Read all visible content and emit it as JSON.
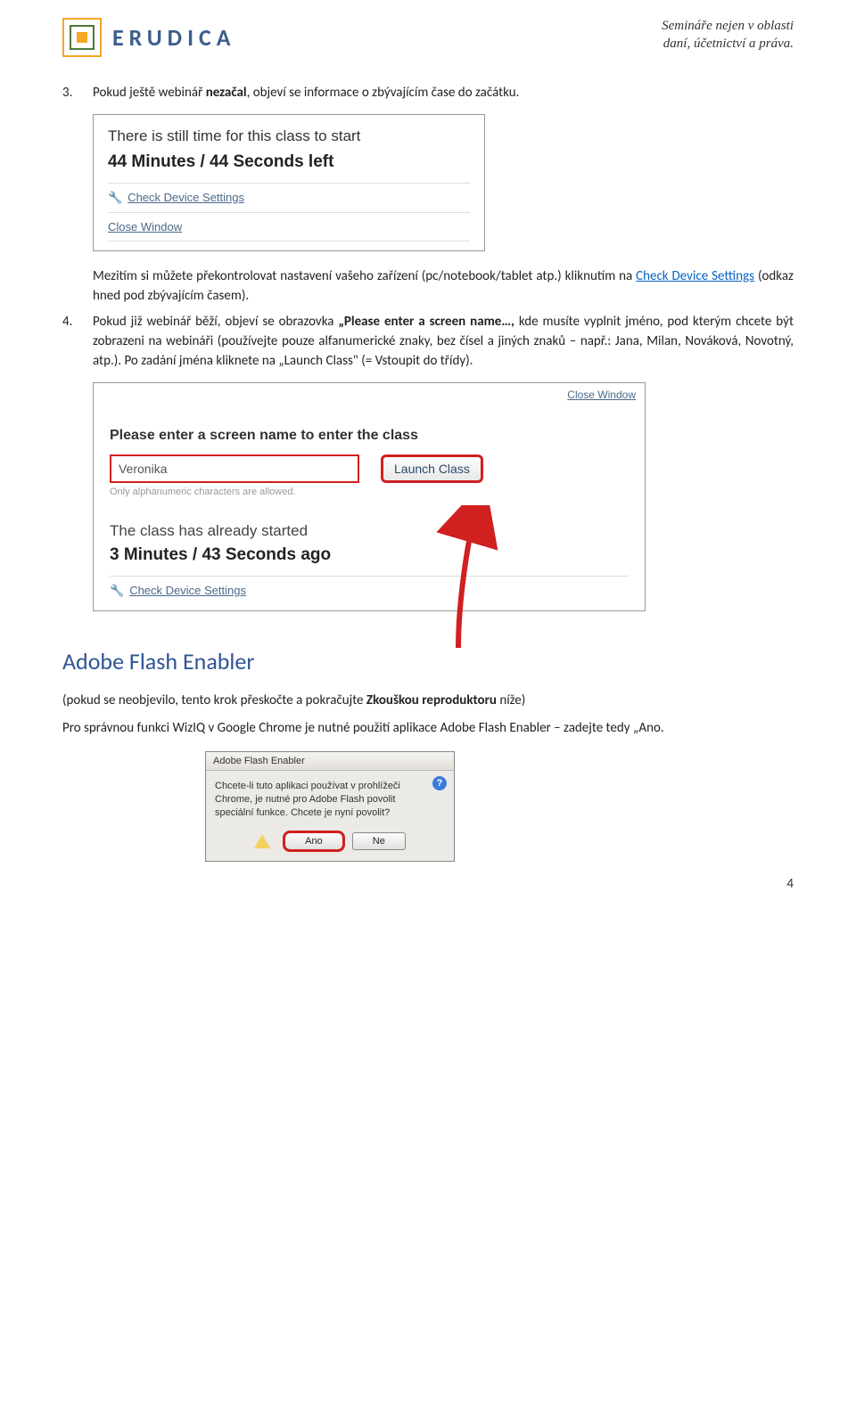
{
  "header": {
    "brand": "ERUDICA",
    "tagline1": "Semináře nejen v oblasti",
    "tagline2": "daní, účetnictví a práva."
  },
  "step3": {
    "num": "3.",
    "text_before_bold": "Pokud ještě webinář ",
    "bold": "nezačal",
    "text_after_bold": ", objeví se informace o zbývajícím čase do začátku."
  },
  "shot1": {
    "title": "There is still time for this class to start",
    "time": "44 Minutes / 44 Seconds left",
    "check": "Check Device Settings",
    "close": "Close Window"
  },
  "step3b": {
    "text_a": "Mezitím si můžete překontrolovat nastavení vašeho zařízení (pc/notebook/tablet atp.) kliknutím na ",
    "link": "Check Device Settings",
    "text_b": " (odkaz hned pod zbývajícím časem)."
  },
  "step4": {
    "num": "4.",
    "t1": "Pokud již webinář běží, objeví se obrazovka ",
    "b1": "„Please enter a screen name…,",
    "t2": " kde musíte vyplnit jméno, pod kterým chcete být zobrazeni na webináři (používejte pouze alfanumerické znaky, bez čísel a jiných znaků – např.: Jana, Milan, Nováková, Novotný, atp.). Po zadání jména kliknete na „Launch Class\" (= Vstoupit do třídy)."
  },
  "shot2": {
    "close": "Close Window",
    "prompt": "Please enter a screen name to enter the class",
    "name_value": "Veronika",
    "launch": "Launch Class",
    "hint": "Only alphanumeric characters are allowed.",
    "started_title": "The class has already started",
    "started_time": "3 Minutes / 43 Seconds ago",
    "check": "Check Device Settings"
  },
  "section": {
    "title": "Adobe Flash Enabler",
    "p1a": "(pokud se neobjevilo, tento krok přeskočte a pokračujte ",
    "p1b": "Zkouškou reproduktoru",
    "p1c": " níže)",
    "p2": "Pro správnou funkci WizIQ v Google Chrome je nutné použití aplikace Adobe Flash Enabler – zadejte tedy „Ano."
  },
  "shot3": {
    "title": "Adobe Flash Enabler",
    "text": "Chcete-li tuto aplikaci používat v prohlížeči Chrome, je nutné pro Adobe Flash povolit speciální funkce. Chcete je nyní povolit?",
    "yes": "Ano",
    "no": "Ne"
  },
  "page_number": "4"
}
